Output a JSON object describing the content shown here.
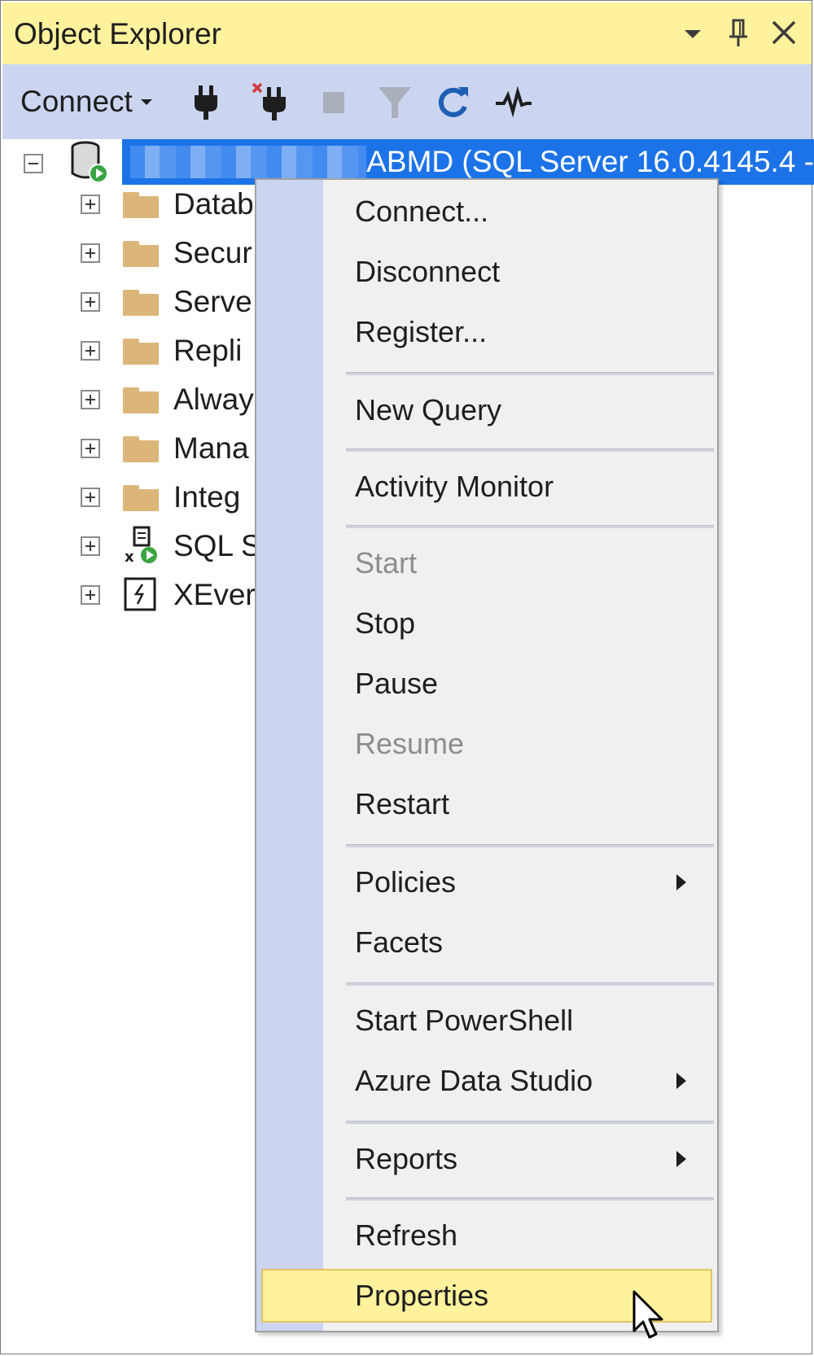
{
  "panel": {
    "title": "Object Explorer",
    "controls": {
      "dropdown": "chevron-down-icon",
      "pin": "pin-icon",
      "close": "close-icon"
    }
  },
  "toolbar": {
    "connect_label": "Connect",
    "icons": [
      "connect-plug-icon",
      "disconnect-plug-icon",
      "stop-icon",
      "filter-icon",
      "refresh-icon",
      "activity-monitor-icon"
    ]
  },
  "tree": {
    "server_label": "ABMD (SQL Server 16.0.4145.4 -",
    "children": [
      {
        "label": "Datab",
        "icon": "folder-icon"
      },
      {
        "label": "Secur",
        "icon": "folder-icon"
      },
      {
        "label": "Serve",
        "icon": "folder-icon"
      },
      {
        "label": "Repli",
        "icon": "folder-icon"
      },
      {
        "label": "Alway",
        "icon": "folder-icon"
      },
      {
        "label": "Mana",
        "icon": "folder-icon"
      },
      {
        "label": "Integ",
        "icon": "folder-icon"
      },
      {
        "label": "SQL S",
        "icon": "sql-agent-icon"
      },
      {
        "label": "XEver",
        "icon": "xevent-profiler-icon"
      }
    ]
  },
  "context_menu": {
    "items": [
      {
        "label": "Connect...",
        "enabled": true
      },
      {
        "label": "Disconnect",
        "enabled": true
      },
      {
        "label": "Register...",
        "enabled": true
      },
      {
        "label": "New Query",
        "enabled": true
      },
      {
        "label": "Activity Monitor",
        "enabled": true
      },
      {
        "label": "Start",
        "enabled": false
      },
      {
        "label": "Stop",
        "enabled": true
      },
      {
        "label": "Pause",
        "enabled": true
      },
      {
        "label": "Resume",
        "enabled": false
      },
      {
        "label": "Restart",
        "enabled": true
      },
      {
        "label": "Policies",
        "enabled": true,
        "submenu": true
      },
      {
        "label": "Facets",
        "enabled": true
      },
      {
        "label": "Start PowerShell",
        "enabled": true
      },
      {
        "label": "Azure Data Studio",
        "enabled": true,
        "submenu": true
      },
      {
        "label": "Reports",
        "enabled": true,
        "submenu": true
      },
      {
        "label": "Refresh",
        "enabled": true
      },
      {
        "label": "Properties",
        "enabled": true,
        "highlighted": true
      }
    ]
  },
  "colors": {
    "title_bar": "#fff29d",
    "toolbar": "#ccd5f0",
    "selection": "#1c73e8",
    "menu_background": "#f0f0f0",
    "menu_gutter": "#ccd5f0",
    "highlight": "#fff29d",
    "folder": "#dcb679"
  }
}
